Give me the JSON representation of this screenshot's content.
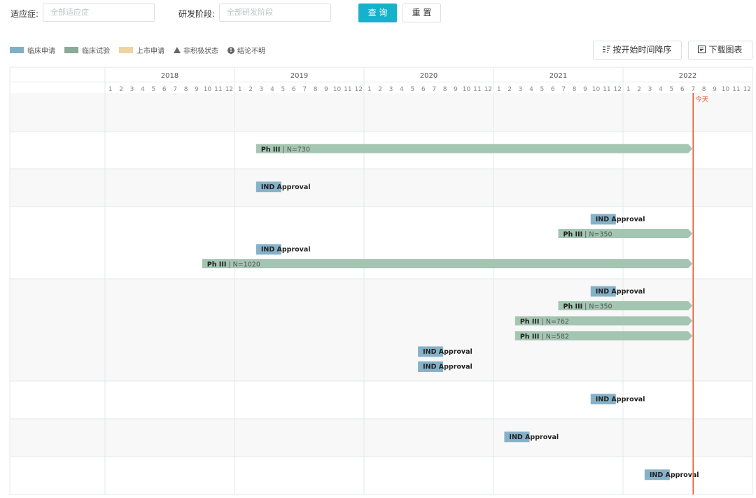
{
  "filters": {
    "indication_label": "适应症:",
    "indication_placeholder": "全部适应症",
    "stage_label": "研发阶段:",
    "stage_placeholder": "全部研发阶段",
    "query_label": "查 询",
    "reset_label": "重 置"
  },
  "legend": {
    "items": [
      {
        "label": "临床申请",
        "color": "#7fb0c8",
        "shape": "swatch"
      },
      {
        "label": "临床试验",
        "color": "#8aab98",
        "shape": "swatch"
      },
      {
        "label": "上市申请",
        "color": "#efd3a2",
        "shape": "swatch"
      },
      {
        "label": "非积极状态",
        "color": "#666666",
        "shape": "triangle"
      },
      {
        "label": "结论不明",
        "color": "#666666",
        "shape": "exclamation"
      }
    ]
  },
  "toolbar": {
    "sort_label": "按开始时间降序",
    "sort_icon": "sort-descending-icon",
    "download_label": "下载图表",
    "download_icon": "download-chart-icon"
  },
  "chart_data": {
    "type": "gantt",
    "years": [
      "2018",
      "2019",
      "2020",
      "2021",
      "2022"
    ],
    "months": [
      "1",
      "2",
      "3",
      "4",
      "5",
      "6",
      "7",
      "8",
      "9",
      "10",
      "11",
      "12"
    ],
    "today_label": "今天",
    "today": "2022-07",
    "colors": {
      "clinical_application": "#86b2c9",
      "clinical_trial": "#a4c5b1",
      "today": "#e8562a"
    },
    "rows": [
      {
        "bars": []
      },
      {
        "bars": [
          {
            "kind": "trial",
            "phase": "Ph III",
            "detail": "N=730",
            "start": "2019-03",
            "end": "2022-07"
          }
        ]
      },
      {
        "bars": [
          {
            "kind": "application",
            "phase": "IND Approval",
            "detail": "",
            "start": "2019-03"
          }
        ]
      },
      {
        "bars": [
          {
            "kind": "application",
            "phase": "IND Approval",
            "detail": "",
            "start": "2021-10"
          },
          {
            "kind": "trial",
            "phase": "Ph III",
            "detail": "N=350",
            "start": "2021-07",
            "end": "2022-07"
          },
          {
            "kind": "application",
            "phase": "IND Approval",
            "detail": "",
            "start": "2019-03"
          },
          {
            "kind": "trial",
            "phase": "Ph III",
            "detail": "N=1020",
            "start": "2018-10",
            "end": "2022-07"
          }
        ]
      },
      {
        "bars": [
          {
            "kind": "application",
            "phase": "IND Approval",
            "detail": "",
            "start": "2021-10"
          },
          {
            "kind": "trial",
            "phase": "Ph III",
            "detail": "N=350",
            "start": "2021-07",
            "end": "2022-07"
          },
          {
            "kind": "trial",
            "phase": "Ph III",
            "detail": "N=762",
            "start": "2021-03",
            "end": "2022-07"
          },
          {
            "kind": "trial",
            "phase": "Ph III",
            "detail": "N=582",
            "start": "2021-03",
            "end": "2022-07"
          },
          {
            "kind": "application",
            "phase": "IND Approval",
            "detail": "",
            "start": "2020-06"
          },
          {
            "kind": "application",
            "phase": "IND Approval",
            "detail": "",
            "start": "2020-06"
          }
        ]
      },
      {
        "bars": [
          {
            "kind": "application",
            "phase": "IND Approval",
            "detail": "",
            "start": "2021-10"
          }
        ]
      },
      {
        "bars": [
          {
            "kind": "application",
            "phase": "IND Approval",
            "detail": "",
            "start": "2021-02"
          }
        ]
      },
      {
        "bars": [
          {
            "kind": "application",
            "phase": "IND Approval",
            "detail": "",
            "start": "2022-03"
          }
        ]
      }
    ]
  }
}
